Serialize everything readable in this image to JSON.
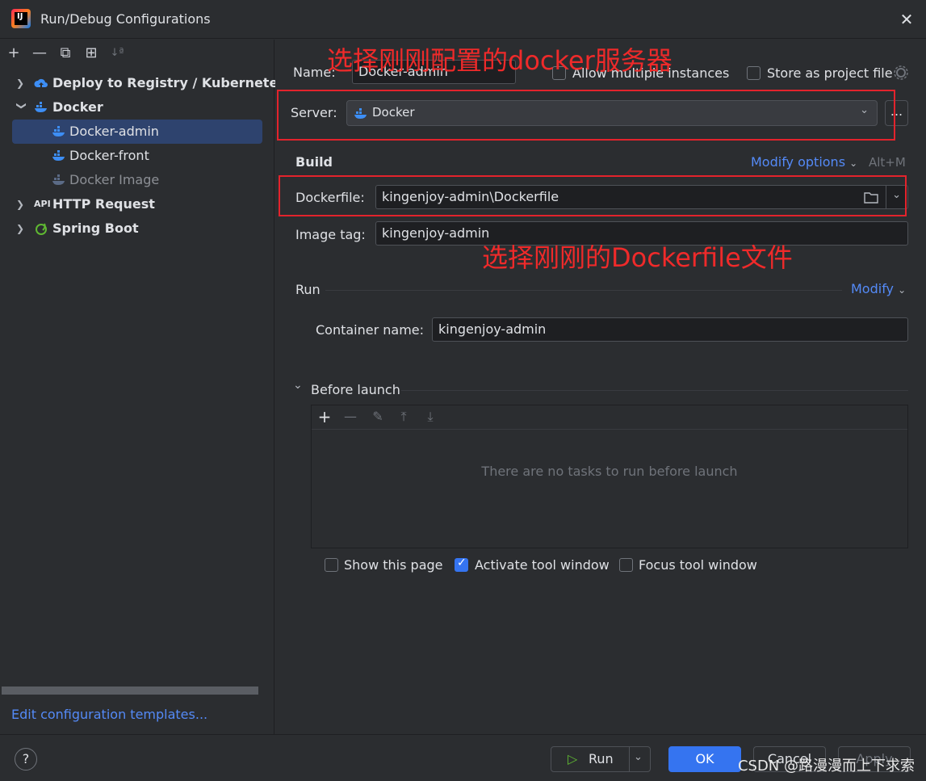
{
  "window": {
    "title": "Run/Debug Configurations",
    "close_glyph": "✕"
  },
  "toolbar": {
    "add": "+",
    "remove": "—",
    "copy": "⧉",
    "folder": "⊞",
    "sort": "↓ª"
  },
  "tree": {
    "items": [
      {
        "label": "Deploy to Registry / Kubernetes"
      },
      {
        "label": "Docker"
      },
      {
        "label": "Docker-admin"
      },
      {
        "label": "Docker-front"
      },
      {
        "label": "Docker Image"
      },
      {
        "label": "HTTP Request"
      },
      {
        "label": "Spring Boot"
      }
    ]
  },
  "templates_link": "Edit configuration templates...",
  "form": {
    "name_label": "Name:",
    "name_value": "Docker-admin",
    "allow_multiple_label": "Allow multiple instances",
    "store_project_label": "Store as project file",
    "server_label": "Server:",
    "server_value": "Docker",
    "server_more": "...",
    "build_title": "Build",
    "modify_options": "Modify options",
    "modify_shortcut": "Alt+M",
    "dockerfile_label": "Dockerfile:",
    "dockerfile_value": "kingenjoy-admin\\Dockerfile",
    "image_tag_label": "Image tag:",
    "image_tag_value": "kingenjoy-admin",
    "run_title": "Run",
    "modify_link": "Modify",
    "container_label": "Container name:",
    "container_value": "kingenjoy-admin",
    "before_launch_title": "Before launch",
    "before_launch_empty": "There are no tasks to run before launch",
    "show_page_label": "Show this page",
    "activate_tool_label": "Activate tool window",
    "focus_tool_label": "Focus tool window"
  },
  "annotations": {
    "server_note": "选择刚刚配置的docker服务器",
    "dockerfile_note": "选择刚刚的Dockerfile文件"
  },
  "footer": {
    "help": "?",
    "run_label": "Run",
    "ok_label": "OK",
    "cancel_label": "Cancel",
    "apply_label": "Apply",
    "watermark": "CSDN @路漫漫而上下求索"
  },
  "colors": {
    "accent": "#3574f0",
    "link": "#548af7",
    "annotation": "#e3232c",
    "selection": "#2e436e"
  }
}
